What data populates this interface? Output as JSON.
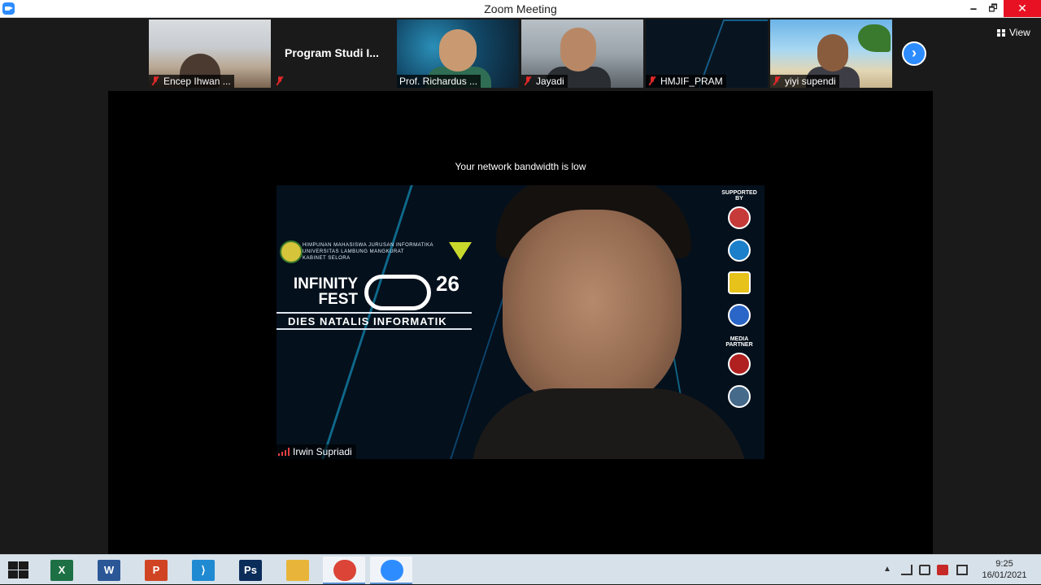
{
  "window": {
    "title": "Zoom Meeting",
    "minimize": "🗕",
    "restore": "🗗",
    "close": "✕"
  },
  "participants": [
    {
      "name": "Encep Ihwan ...",
      "muted": true
    },
    {
      "name": "",
      "display_name": "Program Studi I...",
      "muted": true
    },
    {
      "name": "Prof. Richardus ...",
      "muted": false
    },
    {
      "name": "Jayadi",
      "muted": true
    },
    {
      "name": "HMJIF_PRAM",
      "muted": true
    },
    {
      "name": "yiyi supendi",
      "muted": true
    }
  ],
  "strip": {
    "next_icon": "›",
    "view_label": "View"
  },
  "active_speaker": {
    "warning": "Your network bandwidth is low",
    "name": "Irwin Supriadi",
    "background": {
      "org_text": "HIMPUNAN MAHASISWA JURUSAN INFORMATIKA\nUNIVERSITAS LAMBUNG MANGKURAT\nKABINET SELORA",
      "brand": "INFINITY\nFEST",
      "number": "26",
      "tagline": "DIES NATALIS INFORMATIK",
      "supported_by": "SUPPORTED BY",
      "media_partner": "MEDIA PARTNER"
    }
  },
  "taskbar": {
    "apps": [
      {
        "name": "excel",
        "glyph": "X",
        "color": "#1d7044"
      },
      {
        "name": "word",
        "glyph": "W",
        "color": "#2b5797"
      },
      {
        "name": "powerpoint",
        "glyph": "P",
        "color": "#d04423"
      },
      {
        "name": "vscode",
        "glyph": "⟩",
        "color": "#1f8ad2"
      },
      {
        "name": "photoshop",
        "glyph": "Ps",
        "color": "#0b2d5a"
      },
      {
        "name": "file-explorer",
        "glyph": "",
        "color": "#e8b53a"
      },
      {
        "name": "chrome",
        "glyph": "",
        "color": "#db4437"
      },
      {
        "name": "zoom",
        "glyph": "",
        "color": "#2d8cff"
      }
    ],
    "time": "9:25",
    "date": "16/01/2021"
  }
}
